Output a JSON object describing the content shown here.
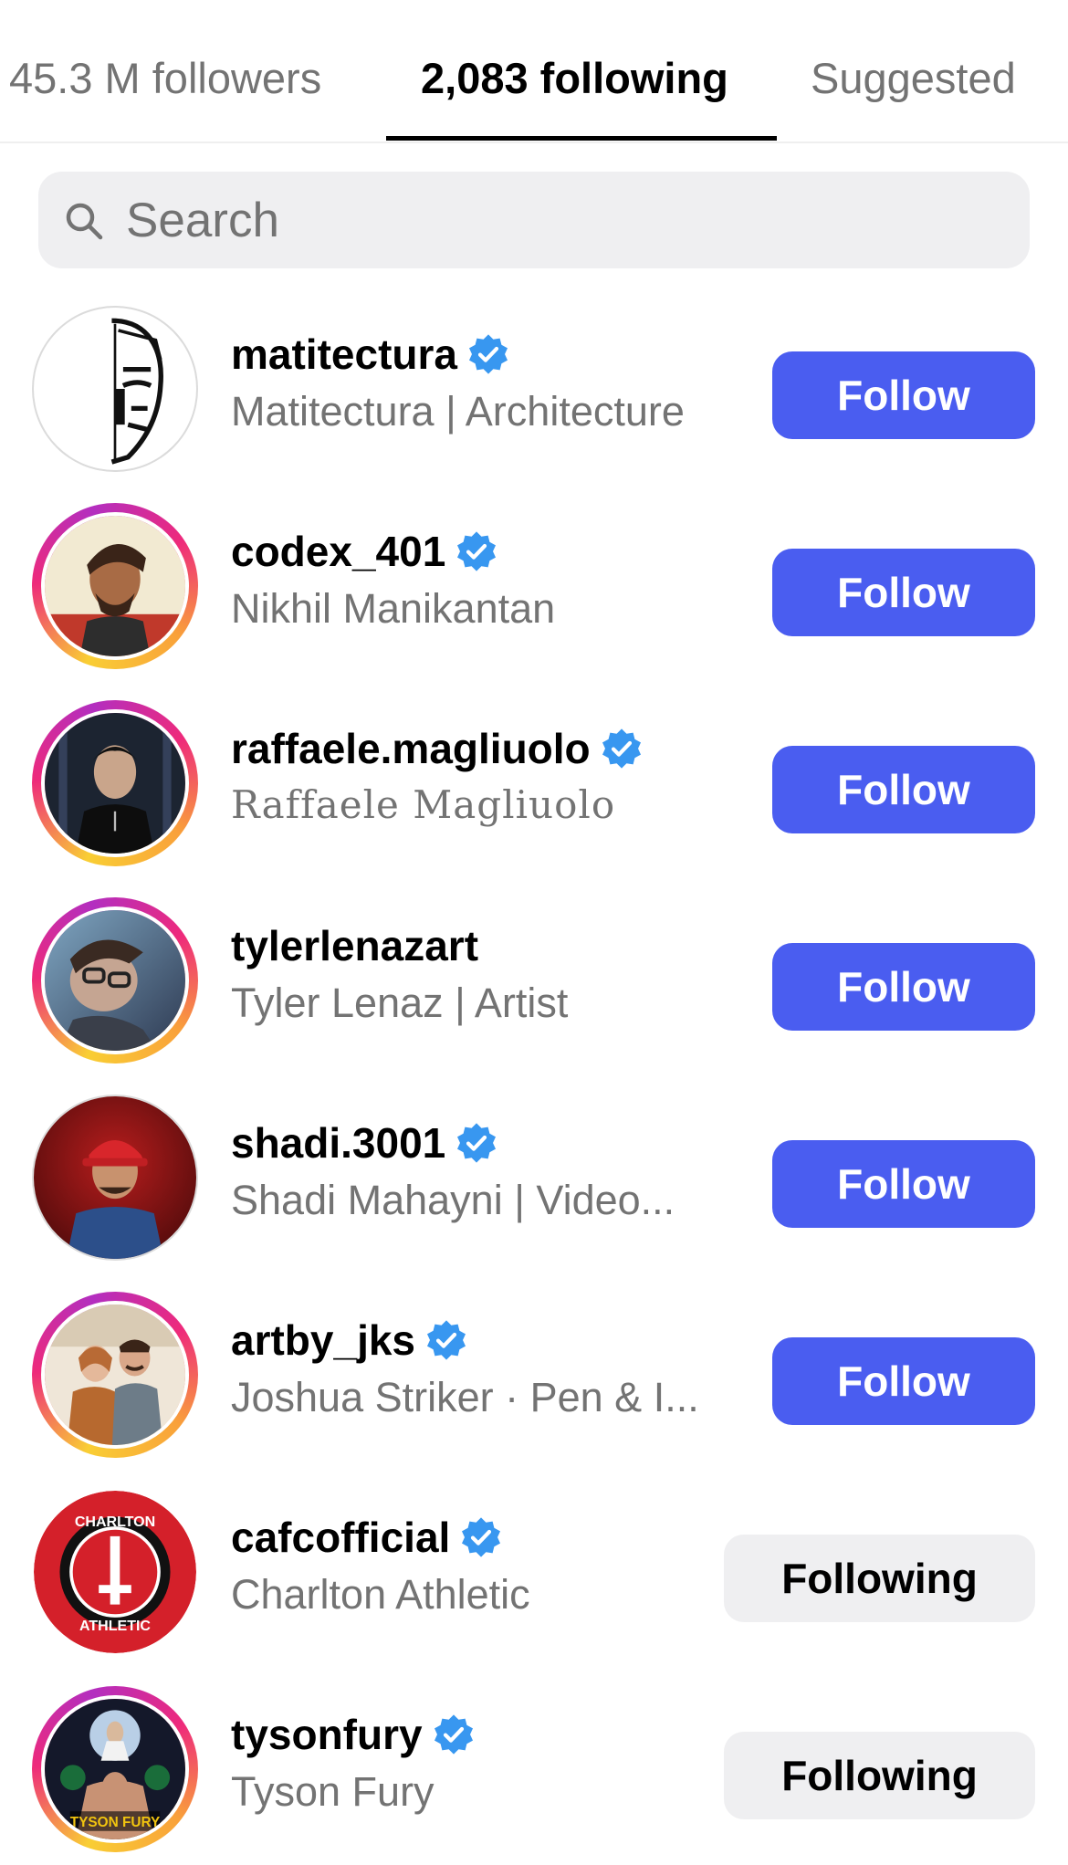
{
  "tabs": {
    "followers": "45.3 M followers",
    "following": "2,083 following",
    "suggested": "Suggested"
  },
  "search": {
    "placeholder": "Search"
  },
  "accounts": [
    {
      "username": "matitectura",
      "name": "Matitectura | Architecture",
      "verified": true,
      "action": "Follow"
    },
    {
      "username": "codex_401",
      "name": "Nikhil Manikantan",
      "verified": true,
      "action": "Follow"
    },
    {
      "username": "raffaele.magliuolo",
      "name": "Raffaele Magliuolo",
      "verified": true,
      "action": "Follow"
    },
    {
      "username": "tylerlenazart",
      "name": "Tyler Lenaz | Artist",
      "verified": false,
      "action": "Follow"
    },
    {
      "username": "shadi.3001",
      "name": "Shadi Mahayni | Video...",
      "verified": true,
      "action": "Follow"
    },
    {
      "username": "artby_jks",
      "name": "Joshua Striker · Pen & I...",
      "verified": true,
      "action": "Follow"
    },
    {
      "username": "cafcofficial",
      "name": "Charlton Athletic",
      "verified": true,
      "action": "Following"
    },
    {
      "username": "tysonfury",
      "name": "Tyson Fury",
      "verified": true,
      "action": "Following"
    }
  ],
  "avatar_logos": {
    "charlton_top": "CHARLTON",
    "charlton_bottom": "ATHLETIC",
    "tyson": "TYSON FURY"
  },
  "colors": {
    "follow_button": "#4a5df0",
    "following_button": "#efeff1",
    "verified_badge": "#3897f0",
    "secondary_text": "#737373"
  }
}
